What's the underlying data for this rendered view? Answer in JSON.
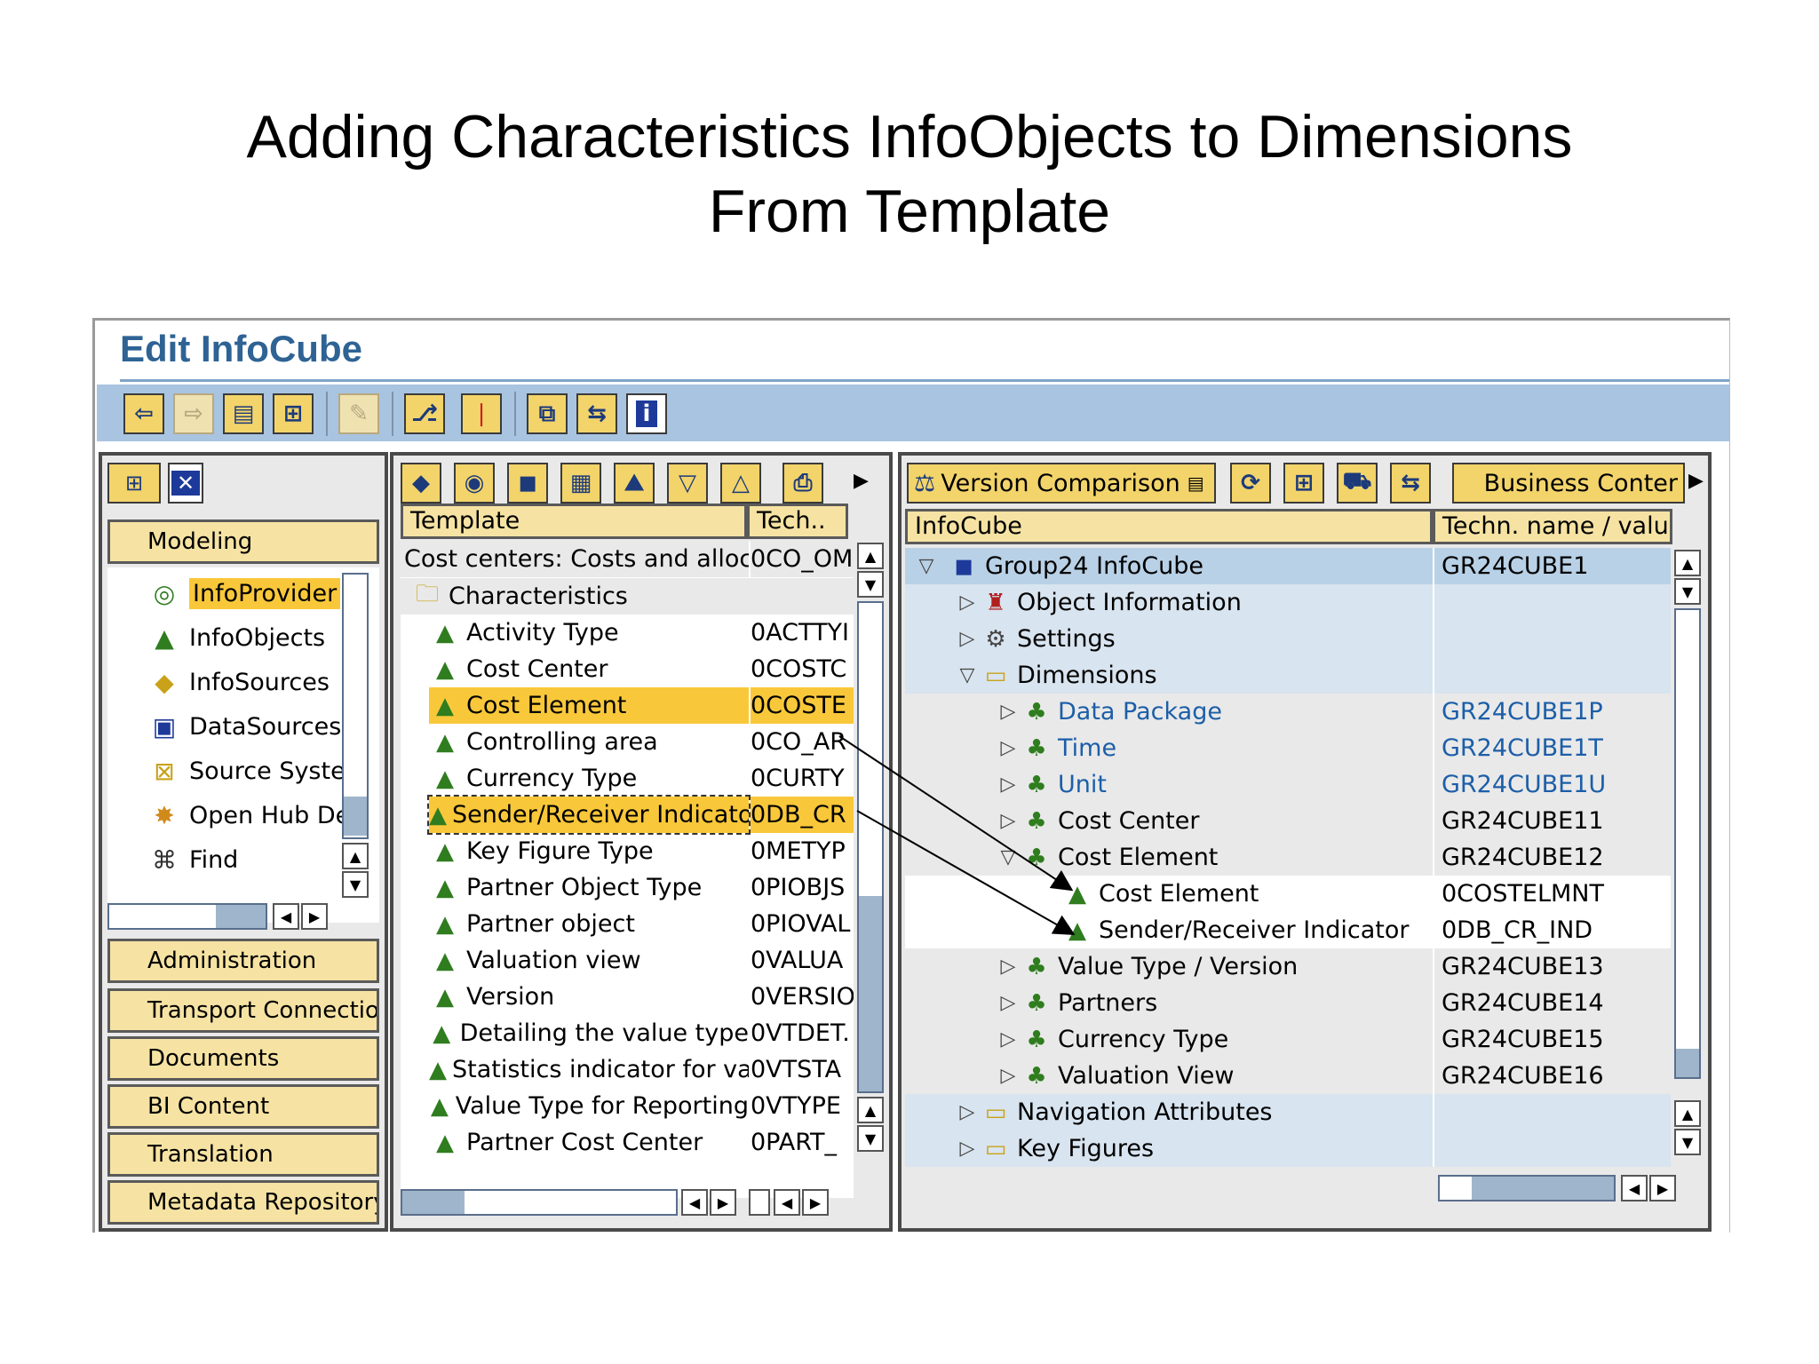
{
  "slide": {
    "title_line1": "Adding Characteristics InfoObjects to Dimensions",
    "title_line2": "From Template"
  },
  "window": {
    "title": "Edit InfoCube"
  },
  "left_panel": {
    "sections": {
      "modeling": "Modeling",
      "administration": "Administration",
      "transport": "Transport Connectio",
      "documents": "Documents",
      "bi_content": "BI Content",
      "translation": "Translation",
      "metadata": "Metadata Repository"
    },
    "items": [
      {
        "label": "InfoProvider",
        "icon": "target-icon",
        "selected": true
      },
      {
        "label": "InfoObjects",
        "icon": "infoobject-icon"
      },
      {
        "label": "InfoSources",
        "icon": "infosource-icon"
      },
      {
        "label": "DataSources",
        "icon": "datasource-icon"
      },
      {
        "label": "Source Syste",
        "icon": "source-system-icon"
      },
      {
        "label": "Open Hub De",
        "icon": "open-hub-icon"
      },
      {
        "label": "Find",
        "icon": "binoculars-icon"
      }
    ]
  },
  "template_panel": {
    "col_template": "Template",
    "col_tech": "Tech..",
    "rows": [
      {
        "label": "Cost centers: Costs and allocat",
        "tech": "0CO_OM"
      },
      {
        "label": "Characteristics",
        "tech": ""
      },
      {
        "label": "Activity Type",
        "tech": "0ACTTYI"
      },
      {
        "label": "Cost Center",
        "tech": "0COSTC"
      },
      {
        "label": "Cost Element",
        "tech": "0COSTE"
      },
      {
        "label": "Controlling area",
        "tech": "0CO_AR"
      },
      {
        "label": "Currency Type",
        "tech": "0CURTY"
      },
      {
        "label": "Sender/Receiver Indicato",
        "tech": "0DB_CR"
      },
      {
        "label": "Key Figure Type",
        "tech": "0METYP"
      },
      {
        "label": "Partner Object Type",
        "tech": "0PIOBJS"
      },
      {
        "label": "Partner object",
        "tech": "0PIOVAL"
      },
      {
        "label": "Valuation view",
        "tech": "0VALUA"
      },
      {
        "label": "Version",
        "tech": "0VERSIO"
      },
      {
        "label": "Detailing the value type",
        "tech": "0VTDET."
      },
      {
        "label": "Statistics indicator for va",
        "tech": "0VTSTA"
      },
      {
        "label": "Value Type for Reporting",
        "tech": "0VTYPE"
      },
      {
        "label": "Partner Cost Center",
        "tech": "0PART_"
      }
    ]
  },
  "infocube_panel": {
    "toolbar": {
      "version_comparison": "Version Comparison",
      "business_content": "Business Conter"
    },
    "col_infocube": "InfoCube",
    "col_tech": "Techn. name / value",
    "rows": [
      {
        "label": "Group24 InfoCube",
        "tech": "GR24CUBE1"
      },
      {
        "label": "Object Information",
        "tech": ""
      },
      {
        "label": "Settings",
        "tech": ""
      },
      {
        "label": "Dimensions",
        "tech": ""
      },
      {
        "label": "Data Package",
        "tech": "GR24CUBE1P"
      },
      {
        "label": "Time",
        "tech": "GR24CUBE1T"
      },
      {
        "label": "Unit",
        "tech": "GR24CUBE1U"
      },
      {
        "label": "Cost Center",
        "tech": "GR24CUBE11"
      },
      {
        "label": "Cost Element",
        "tech": "GR24CUBE12"
      },
      {
        "label": "Cost Element",
        "tech": "0COSTELMNT"
      },
      {
        "label": "Sender/Receiver Indicator",
        "tech": "0DB_CR_IND"
      },
      {
        "label": "Value Type / Version",
        "tech": "GR24CUBE13"
      },
      {
        "label": "Partners",
        "tech": "GR24CUBE14"
      },
      {
        "label": "Currency Type",
        "tech": "GR24CUBE15"
      },
      {
        "label": "Valuation View",
        "tech": "GR24CUBE16"
      },
      {
        "label": "Navigation Attributes",
        "tech": ""
      },
      {
        "label": "Key Figures",
        "tech": ""
      }
    ]
  },
  "colors": {
    "highlight": "#f9c83a",
    "toolbar_bg": "#a9c4e0",
    "title_blue": "#2e6394",
    "section_bg": "#f6e3a3"
  }
}
